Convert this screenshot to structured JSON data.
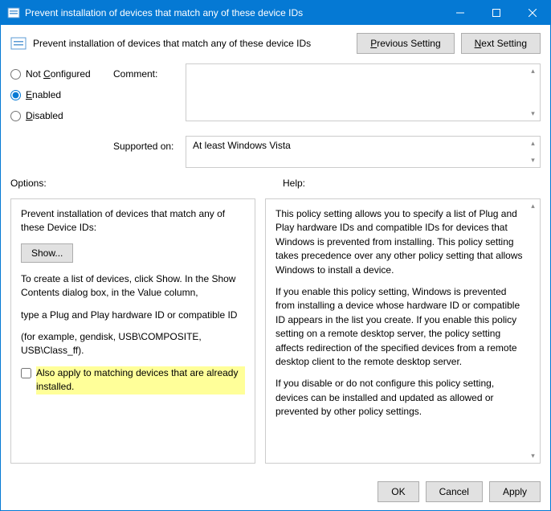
{
  "window": {
    "title": "Prevent installation of devices that match any of these device IDs"
  },
  "header": {
    "title": "Prevent installation of devices that match any of these device IDs",
    "prev": "Previous Setting",
    "next": "Next Setting"
  },
  "radios": {
    "not_configured": "Not Configured",
    "enabled": "Enabled",
    "disabled": "Disabled",
    "selected": "enabled"
  },
  "fields": {
    "comment_label": "Comment:",
    "comment_value": "",
    "supported_label": "Supported on:",
    "supported_value": "At least Windows Vista"
  },
  "sections": {
    "options": "Options:",
    "help": "Help:"
  },
  "options": {
    "line1": "Prevent installation of devices that match any of these Device IDs:",
    "show_btn": "Show...",
    "line2": "To create a list of devices, click Show. In the Show Contents dialog box, in the Value column,",
    "line3": "type a Plug and Play hardware ID or compatible ID",
    "line4": "(for example, gendisk, USB\\COMPOSITE, USB\\Class_ff).",
    "checkbox_label": "Also apply to matching devices that are already installed.",
    "checkbox_checked": false
  },
  "help": {
    "p1": "This policy setting allows you to specify a list of Plug and Play hardware IDs and compatible IDs for devices that Windows is prevented from installing. This policy setting takes precedence over any other policy setting that allows Windows to install a device.",
    "p2": "If you enable this policy setting, Windows is prevented from installing a device whose hardware ID or compatible ID appears in the list you create. If you enable this policy setting on a remote desktop server, the policy setting affects redirection of the specified devices from a remote desktop client to the remote desktop server.",
    "p3": "If you disable or do not configure this policy setting, devices can be installed and updated as allowed or prevented by other policy settings."
  },
  "buttons": {
    "ok": "OK",
    "cancel": "Cancel",
    "apply": "Apply"
  }
}
